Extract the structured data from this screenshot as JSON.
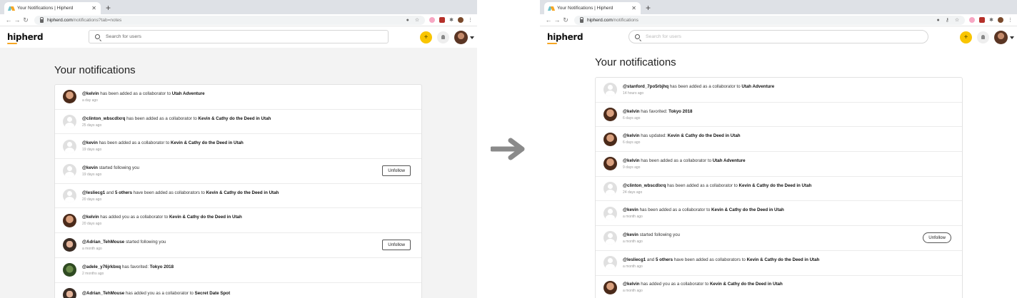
{
  "before": {
    "tab_title": "Your Notifications | Hipherd",
    "url_host": "hipherd.com",
    "url_path": "/notifications?tab=notes",
    "logo": "hipherd",
    "search_placeholder": "Search for users",
    "plus_label": "+",
    "page_title": "Your notifications",
    "notifications": [
      {
        "user": "@kelvin",
        "text": " has been added as a collaborator to ",
        "target": "Utah Adventure",
        "time": "a day ago",
        "avatar": "kelvin"
      },
      {
        "user": "@clinton_wbscdlxrq",
        "text": " has been added as a collaborator to ",
        "target": "Kevin & Cathy do the Deed in Utah",
        "time": "25 days ago",
        "avatar": "placeholder"
      },
      {
        "user": "@kevin",
        "text": " has been added as a collaborator to ",
        "target": "Kevin & Cathy do the Deed in Utah",
        "time": "19 days ago",
        "avatar": "placeholder"
      },
      {
        "user": "@kevin",
        "text": " started following you",
        "target": "",
        "time": "19 days ago",
        "avatar": "placeholder",
        "button": "Unfollow"
      },
      {
        "user": "@lesliecg1",
        "text": " and ",
        "extra": "5 others",
        "text2": " have been added as collaborators to ",
        "target": "Kevin & Cathy do the Deed in Utah",
        "time": "20 days ago",
        "avatar": "placeholder"
      },
      {
        "user": "@kelvin",
        "text": " has added you as a collaborator to ",
        "target": "Kevin & Cathy do the Deed in Utah",
        "time": "20 days ago",
        "avatar": "kelvin"
      },
      {
        "user": "@Adrian_TehMouse",
        "text": " started following you",
        "target": "",
        "time": "a month ago",
        "avatar": "adrian",
        "button": "Unfollow"
      },
      {
        "user": "@adele_y76jrkbxq",
        "text": " has favorited: ",
        "target": "Tokyo 2018",
        "time": "2 months ago",
        "avatar": "green"
      },
      {
        "user": "@Adrian_TehMouse",
        "text": " has added you as a collaborator to ",
        "target": "Secret Date Spot",
        "time": "",
        "avatar": "adrian"
      }
    ]
  },
  "after": {
    "tab_title": "Your Notifications | Hipherd",
    "url_host": "hipherd.com",
    "url_path": "/notifications",
    "logo": "hipherd",
    "search_placeholder": "Search for users",
    "plus_label": "+",
    "page_title": "Your notifications",
    "notifications": [
      {
        "user": "@stanford_7po5rbjhq",
        "text": " has been added as a collaborator to ",
        "target": "Utah Adventure",
        "time": "14 hours ago",
        "avatar": "placeholder"
      },
      {
        "user": "@kelvin",
        "text": " has favorited: ",
        "target": "Tokyo 2018",
        "time": "6 days ago",
        "avatar": "kelvin"
      },
      {
        "user": "@kelvin",
        "text": " has updated: ",
        "target": "Kevin & Cathy do the Deed in Utah",
        "time": "6 days ago",
        "avatar": "kelvin"
      },
      {
        "user": "@kelvin",
        "text": " has been added as a collaborator to ",
        "target": "Utah Adventure",
        "time": "9 days ago",
        "avatar": "kelvin"
      },
      {
        "user": "@clinton_wbscdlxrq",
        "text": " has been added as a collaborator to ",
        "target": "Kevin & Cathy do the Deed in Utah",
        "time": "24 days ago",
        "avatar": "placeholder"
      },
      {
        "user": "@kevin",
        "text": " has been added as a collaborator to ",
        "target": "Kevin & Cathy do the Deed in Utah",
        "time": "a month ago",
        "avatar": "placeholder"
      },
      {
        "user": "@kevin",
        "text": " started following you",
        "target": "",
        "time": "a month ago",
        "avatar": "placeholder",
        "button": "Unfollow"
      },
      {
        "user": "@lesliecg1",
        "text": " and ",
        "extra": "5 others",
        "text2": " have been added as collaborators to ",
        "target": "Kevin & Cathy do the Deed in Utah",
        "time": "a month ago",
        "avatar": "placeholder"
      },
      {
        "user": "@kelvin",
        "text": " has added you as a collaborator to ",
        "target": "Kevin & Cathy do the Deed in Utah",
        "time": "a month ago",
        "avatar": "kelvin"
      }
    ]
  },
  "colors": {
    "accent_yellow": "#f9c500",
    "arrow_gray": "#8a8a8a",
    "page_bg_before": "#f3f3f3"
  },
  "icons": [
    "back-arrow-icon",
    "forward-arrow-icon",
    "reload-icon",
    "lock-icon",
    "search-icon",
    "plus-icon",
    "bell-icon",
    "transition-arrow-icon"
  ]
}
